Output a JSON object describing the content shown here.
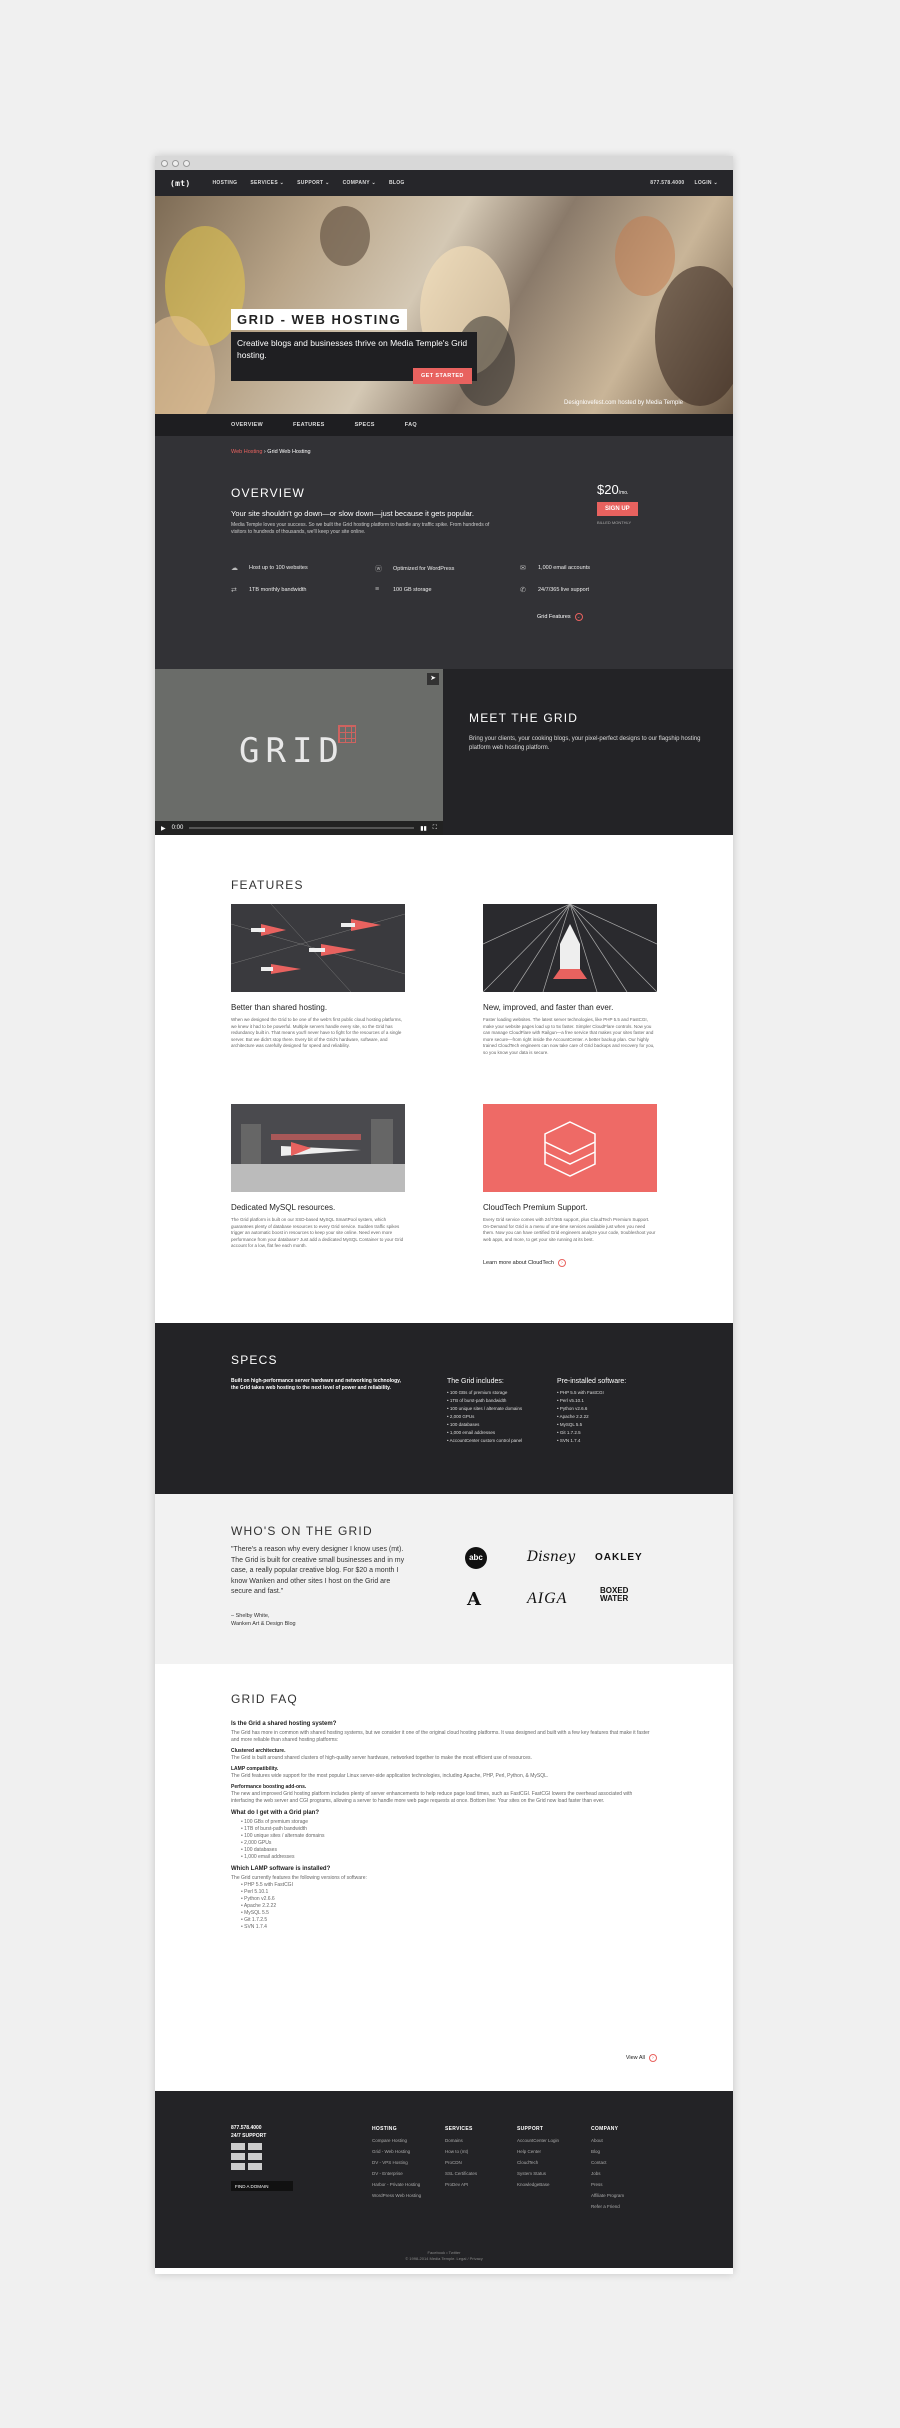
{
  "nav": {
    "logo": "(mt)",
    "links": [
      "HOSTING",
      "SERVICES ⌄",
      "SUPPORT ⌄",
      "COMPANY ⌄",
      "BLOG"
    ],
    "phone": "877.578.4000",
    "login": "LOGIN ⌄"
  },
  "hero": {
    "title": "GRID - WEB HOSTING",
    "subtitle": "Creative blogs and businesses thrive on Media Temple's Grid hosting.",
    "button": "GET STARTED",
    "credit": "Designlovefest.com hosted by Media Temple"
  },
  "subnav": [
    "OVERVIEW",
    "FEATURES",
    "SPECS",
    "FAQ"
  ],
  "overview": {
    "breadcrumb_link": "Web Hosting",
    "breadcrumb_sep": "›",
    "breadcrumb_current": "Grid Web Hosting",
    "title": "OVERVIEW",
    "lead": "Your site shouldn't go down—or slow down—just because it gets popular.",
    "desc": "Media Temple loves your success. So we built the Grid hosting platform to handle any traffic spike. From hundreds of visitors to hundreds of thousands, we'll keep your site online.",
    "price": "$20",
    "per": "/mo.",
    "signup": "SIGN UP",
    "price_note": "BILLED MONTHLY",
    "features": [
      "Host up to 100 websites",
      "Optimized for WordPress",
      "1,000 email accounts",
      "1TB monthly bandwidth",
      "100 GB storage",
      "24/7/365 live support"
    ],
    "grid_features": "Grid Features"
  },
  "meet": {
    "video_title": "GRID",
    "time": "0:00",
    "title": "MEET THE GRID",
    "text": "Bring your clients, your cooking blogs, your pixel-perfect designs to our flagship hosting platform web hosting platform."
  },
  "features": {
    "title": "FEATURES",
    "items": [
      {
        "title": "Better than shared hosting.",
        "body": "When we designed the Grid to be one of the web's first public cloud hosting platforms, we knew it had to be powerful. Multiple servers handle every site, so the Grid has redundancy built in. That means you'll never have to fight for the resources of a single server. But we didn't stop there. Every bit of the Grid's hardware, software, and architecture was carefully designed for speed and reliability."
      },
      {
        "title": "New, improved, and faster than ever.",
        "body": "Faster loading websites. The latest server technologies, like PHP 5.5 and FastCGI, make your website pages load up to 5x faster. Simpler CloudFlare controls. Now you can manage CloudFlare with Railgun—a free service that makes your sites faster and more secure—from right inside the AccountCenter. A better backup plan. Our highly trained CloudTech engineers can now take care of Grid backups and recovery for you, so you know your data is secure."
      },
      {
        "title": "Dedicated MySQL resources.",
        "body": "The Grid platform is built on our SSD-based MySQL SmartPool system, which guarantees plenty of database resources to every Grid service. Sudden traffic spikes trigger an automatic boost in resources to keep your site online. Need even more performance from your database? Just add a dedicated MySQL Container to your Grid account for a low, flat fee each month."
      },
      {
        "title": "CloudTech Premium Support.",
        "body": "Every Grid service comes with 24/7/365 support, plus CloudTech Premium Support. On-Demand for Grid is a menu of one-time services available just when you need them. Now you can have certified Grid engineers analyze your code, troubleshoot your web apps, and more, to get your site running at its best."
      }
    ],
    "learn_more": "Learn more about CloudTech"
  },
  "specs": {
    "title": "SPECS",
    "desc": "Built on high-performance server hardware and networking technology, the Grid takes web hosting to the next level of power and reliability.",
    "includes_title": "The Grid includes:",
    "includes": [
      "100 GBs of premium storage",
      "1TB of burst-path bandwidth",
      "100 unique sites / alternate domains",
      "2,000 GPUs",
      "100 databases",
      "1,000 email addresses",
      "AccountCenter custom control panel"
    ],
    "software_title": "Pre-installed software:",
    "software": [
      "PHP 5.5 with FastCGI",
      "Perl v5.10.1",
      "Python v2.6.6",
      "Apache 2.2.22",
      "MySQL 5.5",
      "Git 1.7.2.5",
      "SVN 1.7.4"
    ]
  },
  "whos": {
    "title": "WHO'S ON THE GRID",
    "quote": "\"There's a reason why every designer I know uses (mt). The Grid is built for creative small businesses and in my case, a really popular creative blog. For $20 a month I know Wanken and other sites I host on the Grid are secure and fast.\"",
    "author": "– Shelby White,",
    "org": "Wanken Art & Design Blog",
    "brands": [
      "abc",
      "Disney",
      "OAKLEY",
      "A",
      "AIGA",
      "BOXED WATER"
    ]
  },
  "faq": {
    "title": "GRID FAQ",
    "q1": "Is the Grid a shared hosting system?",
    "a1": "The Grid has more in common with shared hosting systems, but we consider it one of the original cloud hosting platforms. It was designed and built with a few key features that make it faster and more reliable than shared hosting platforms:",
    "b1": "Clustered architecture.",
    "b1t": "The Grid is built around shared clusters of high-quality server hardware, networked together to make the most efficient use of resources.",
    "b2": "LAMP compatibility.",
    "b2t": "The Grid features wide support for the most popular Linux server-side application technologies, including Apache, PHP, Perl, Python, & MySQL.",
    "b3": "Performance boosting add-ons.",
    "b3t": "The new and improved Grid hosting platform includes plenty of server enhancements to help reduce page load times, such as FastCGI. FastCGI lowers the overhead associated with interfacing the web server and CGI programs, allowing a server to handle more web page requests at once. Bottom line: Your sites on the Grid now load faster than ever.",
    "q2": "What do I get with a Grid plan?",
    "l2": [
      "100 GBs of premium storage",
      "1TB of burst-path bandwidth",
      "100 unique sites / alternate domains",
      "2,000 GPUs",
      "100 databases",
      "1,000 email addresses"
    ],
    "q3": "Which LAMP software is installed?",
    "a3": "The Grid currently features the following versions of software:",
    "l3": [
      "PHP 5.5 with FastCGI",
      "Perl 5.10.1",
      "Python v2.6.6",
      "Apache 2.2.22",
      "MySQL 5.5",
      "Git 1.7.2.5",
      "SVN 1.7.4"
    ],
    "view_all": "View All"
  },
  "footer": {
    "phone": "877.578.4000",
    "support": "24/7 SUPPORT",
    "find": "FIND A DOMAIN",
    "cols": [
      {
        "h": "HOSTING",
        "items": [
          "Compare Hosting",
          "Grid - Web Hosting",
          "DV - VPS Hosting",
          "DV - Enterprise",
          "Harbor - Private Hosting",
          "WordPress Web Hosting"
        ]
      },
      {
        "h": "SERVICES",
        "items": [
          "Domains",
          "How to (mt)",
          "ProCDN",
          "SSL Certificates",
          "ProDev API"
        ]
      },
      {
        "h": "SUPPORT",
        "items": [
          "AccountCenter Login",
          "Help Center",
          "CloudTech",
          "System Status",
          "KnowledgeBase"
        ]
      },
      {
        "h": "COMPANY",
        "items": [
          "About",
          "Blog",
          "Contact",
          "Jobs",
          "Press",
          "Affiliate Program",
          "Refer a Friend"
        ]
      }
    ],
    "social": "Facebook • Twitter",
    "copy": "© 1998-2014 Media Temple. Legal / Privacy"
  },
  "colors": {
    "accent": "#e8625f",
    "dark": "#232326"
  }
}
